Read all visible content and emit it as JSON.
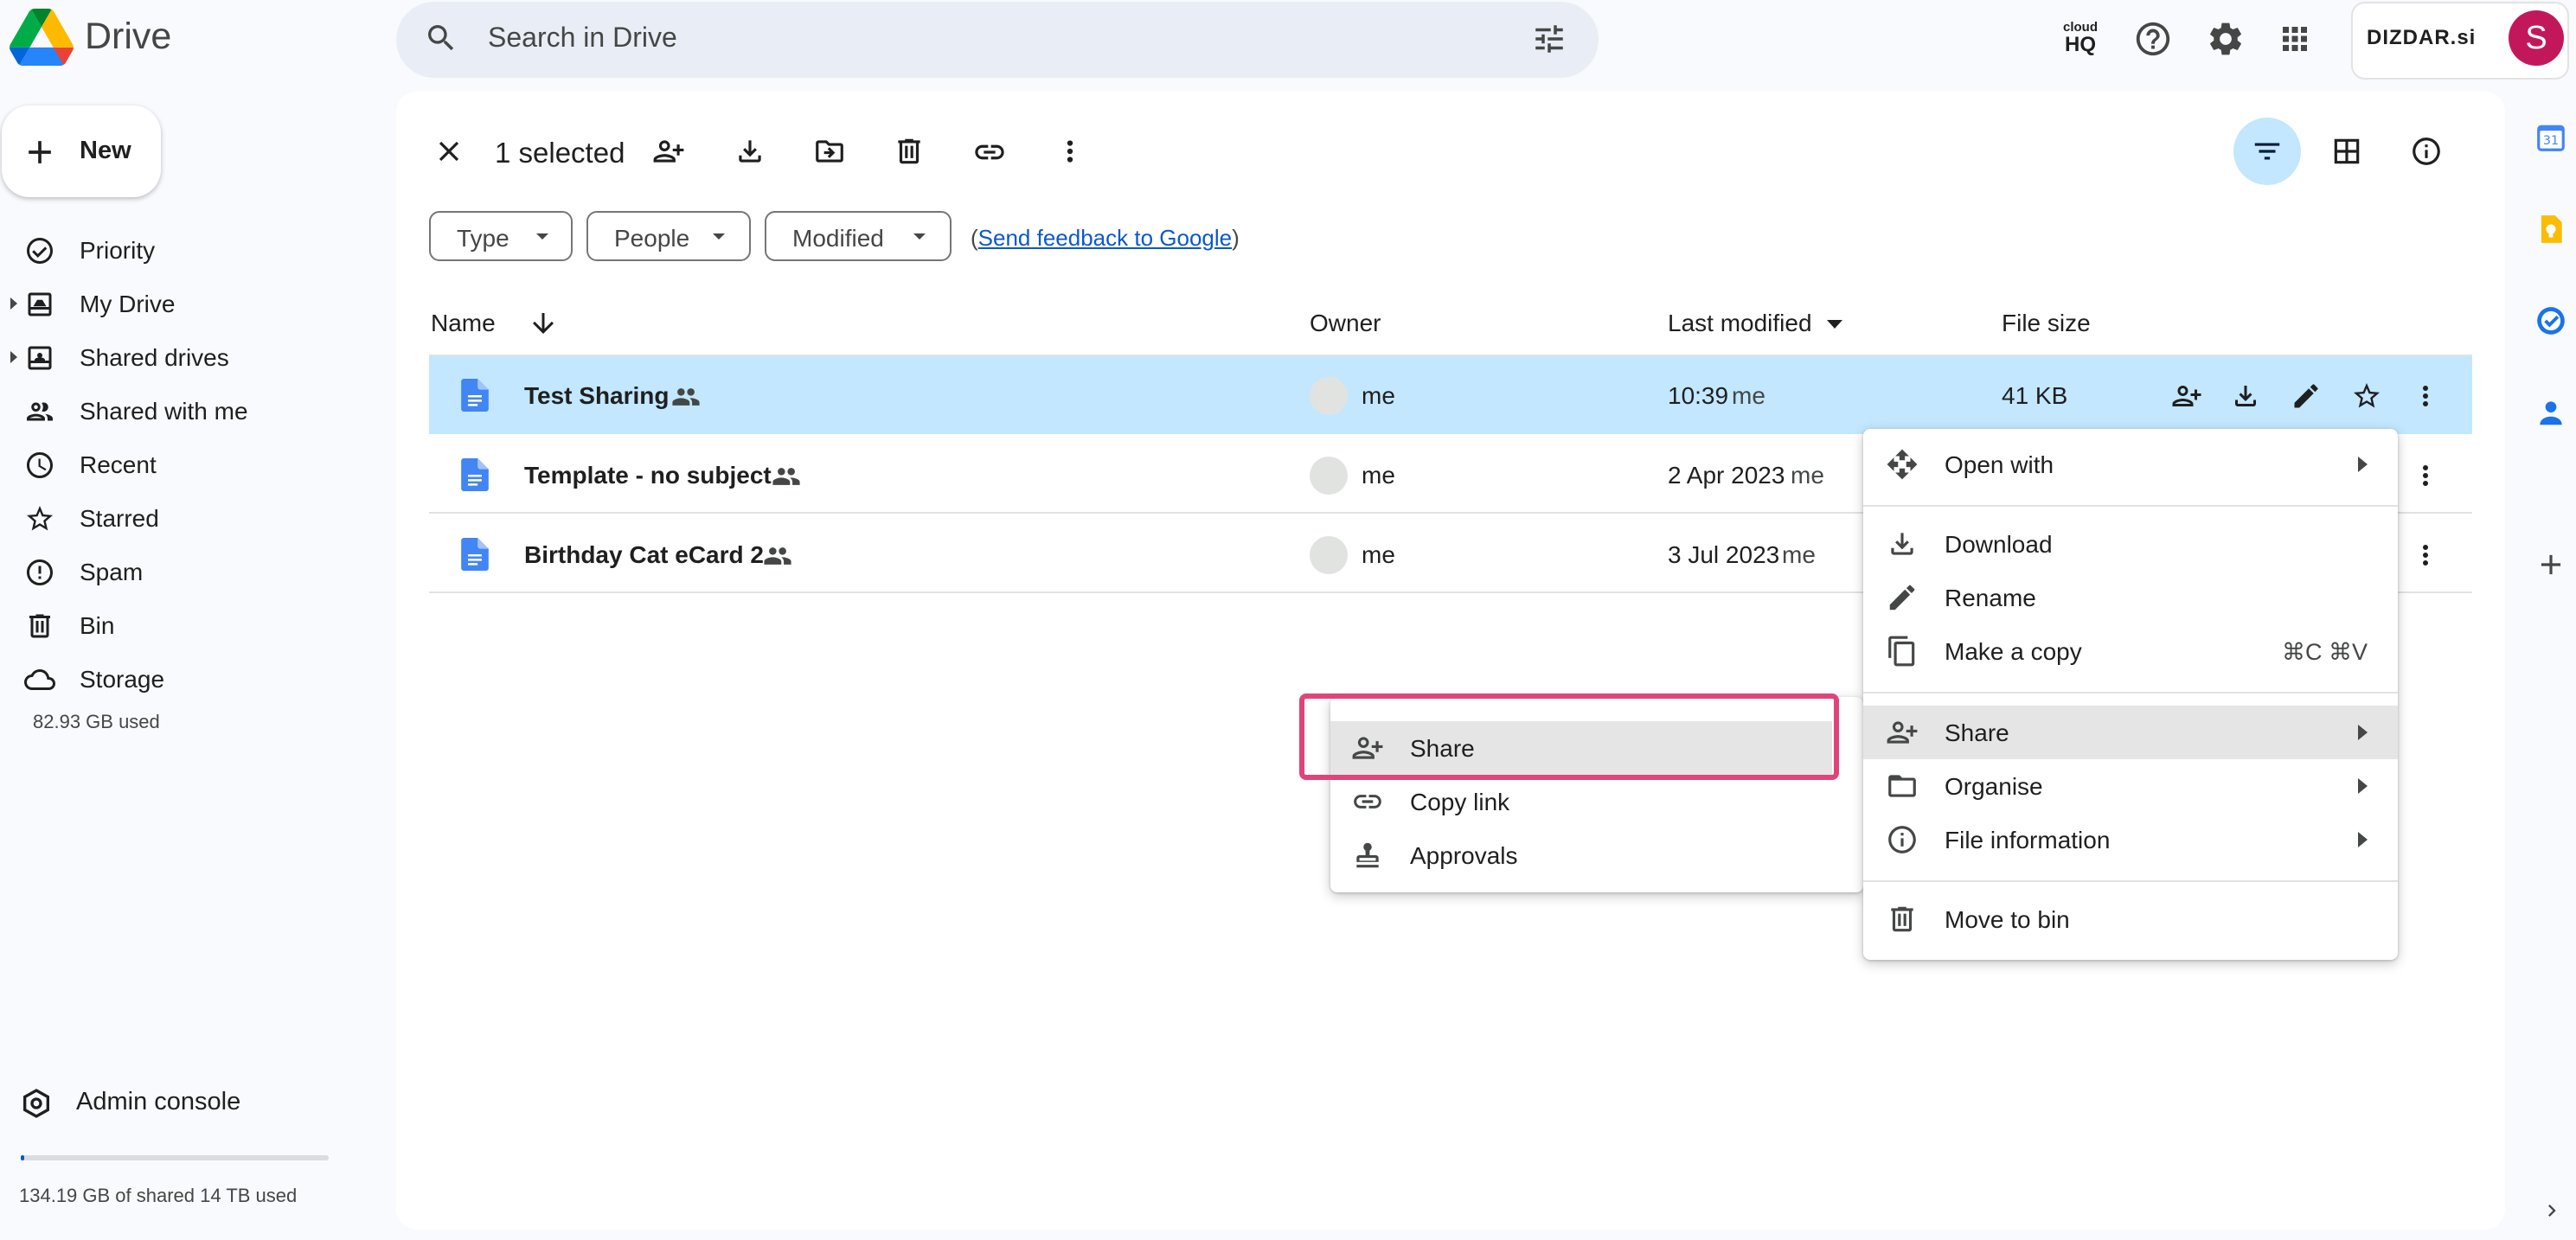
{
  "app": {
    "name": "Drive",
    "search_placeholder": "Search in Drive",
    "brand_label": "DIZDAR.si",
    "avatar_letter": "S",
    "cloudhq_label_top": "cloud",
    "cloudhq_label_bottom": "HQ"
  },
  "sidebar": {
    "new_label": "New",
    "items": [
      {
        "label": "Priority",
        "icon": "priority-icon"
      },
      {
        "label": "My Drive",
        "icon": "my-drive-icon"
      },
      {
        "label": "Shared drives",
        "icon": "shared-drives-icon"
      },
      {
        "label": "Shared with me",
        "icon": "shared-with-me-icon"
      },
      {
        "label": "Recent",
        "icon": "clock-icon"
      },
      {
        "label": "Starred",
        "icon": "star-icon"
      },
      {
        "label": "Spam",
        "icon": "spam-icon"
      },
      {
        "label": "Bin",
        "icon": "bin-icon"
      },
      {
        "label": "Storage",
        "icon": "cloud-icon"
      }
    ],
    "storage_used": "82.93 GB used",
    "admin_label": "Admin console",
    "quota_text": "134.19 GB of shared 14 TB used",
    "quota_fraction": 0.01
  },
  "toolbar": {
    "selected_text": "1 selected"
  },
  "filters": {
    "type": "Type",
    "people": "People",
    "modified": "Modified",
    "feedback_open": "(",
    "feedback_link": "Send feedback to Google",
    "feedback_close": ")"
  },
  "table": {
    "headers": {
      "name": "Name",
      "owner": "Owner",
      "modified": "Last modified",
      "size": "File size"
    },
    "rows": [
      {
        "name": "Test Sharing",
        "owner": "me",
        "modified": "10:39",
        "modified_by": "me",
        "size": "41 KB",
        "selected": true
      },
      {
        "name": "Template - no subject",
        "owner": "me",
        "modified": "2 Apr 2023",
        "modified_by": "me",
        "size": "",
        "selected": false
      },
      {
        "name": "Birthday Cat eCard 2",
        "owner": "me",
        "modified": "3 Jul 2023",
        "modified_by": "me",
        "size": "",
        "selected": false
      }
    ]
  },
  "context_menu": {
    "open_with": "Open with",
    "download": "Download",
    "rename": "Rename",
    "make_copy": "Make a copy",
    "make_copy_shortcut": "⌘C ⌘V",
    "share": "Share",
    "organise": "Organise",
    "file_information": "File information",
    "move_to_bin": "Move to bin"
  },
  "share_submenu": {
    "share": "Share",
    "copy_link": "Copy link",
    "approvals": "Approvals"
  },
  "colors": {
    "selected_row": "#c2e7ff",
    "accent": "#0b57d0",
    "highlight_border": "#e0447a",
    "doc_icon": "#4285f4"
  }
}
